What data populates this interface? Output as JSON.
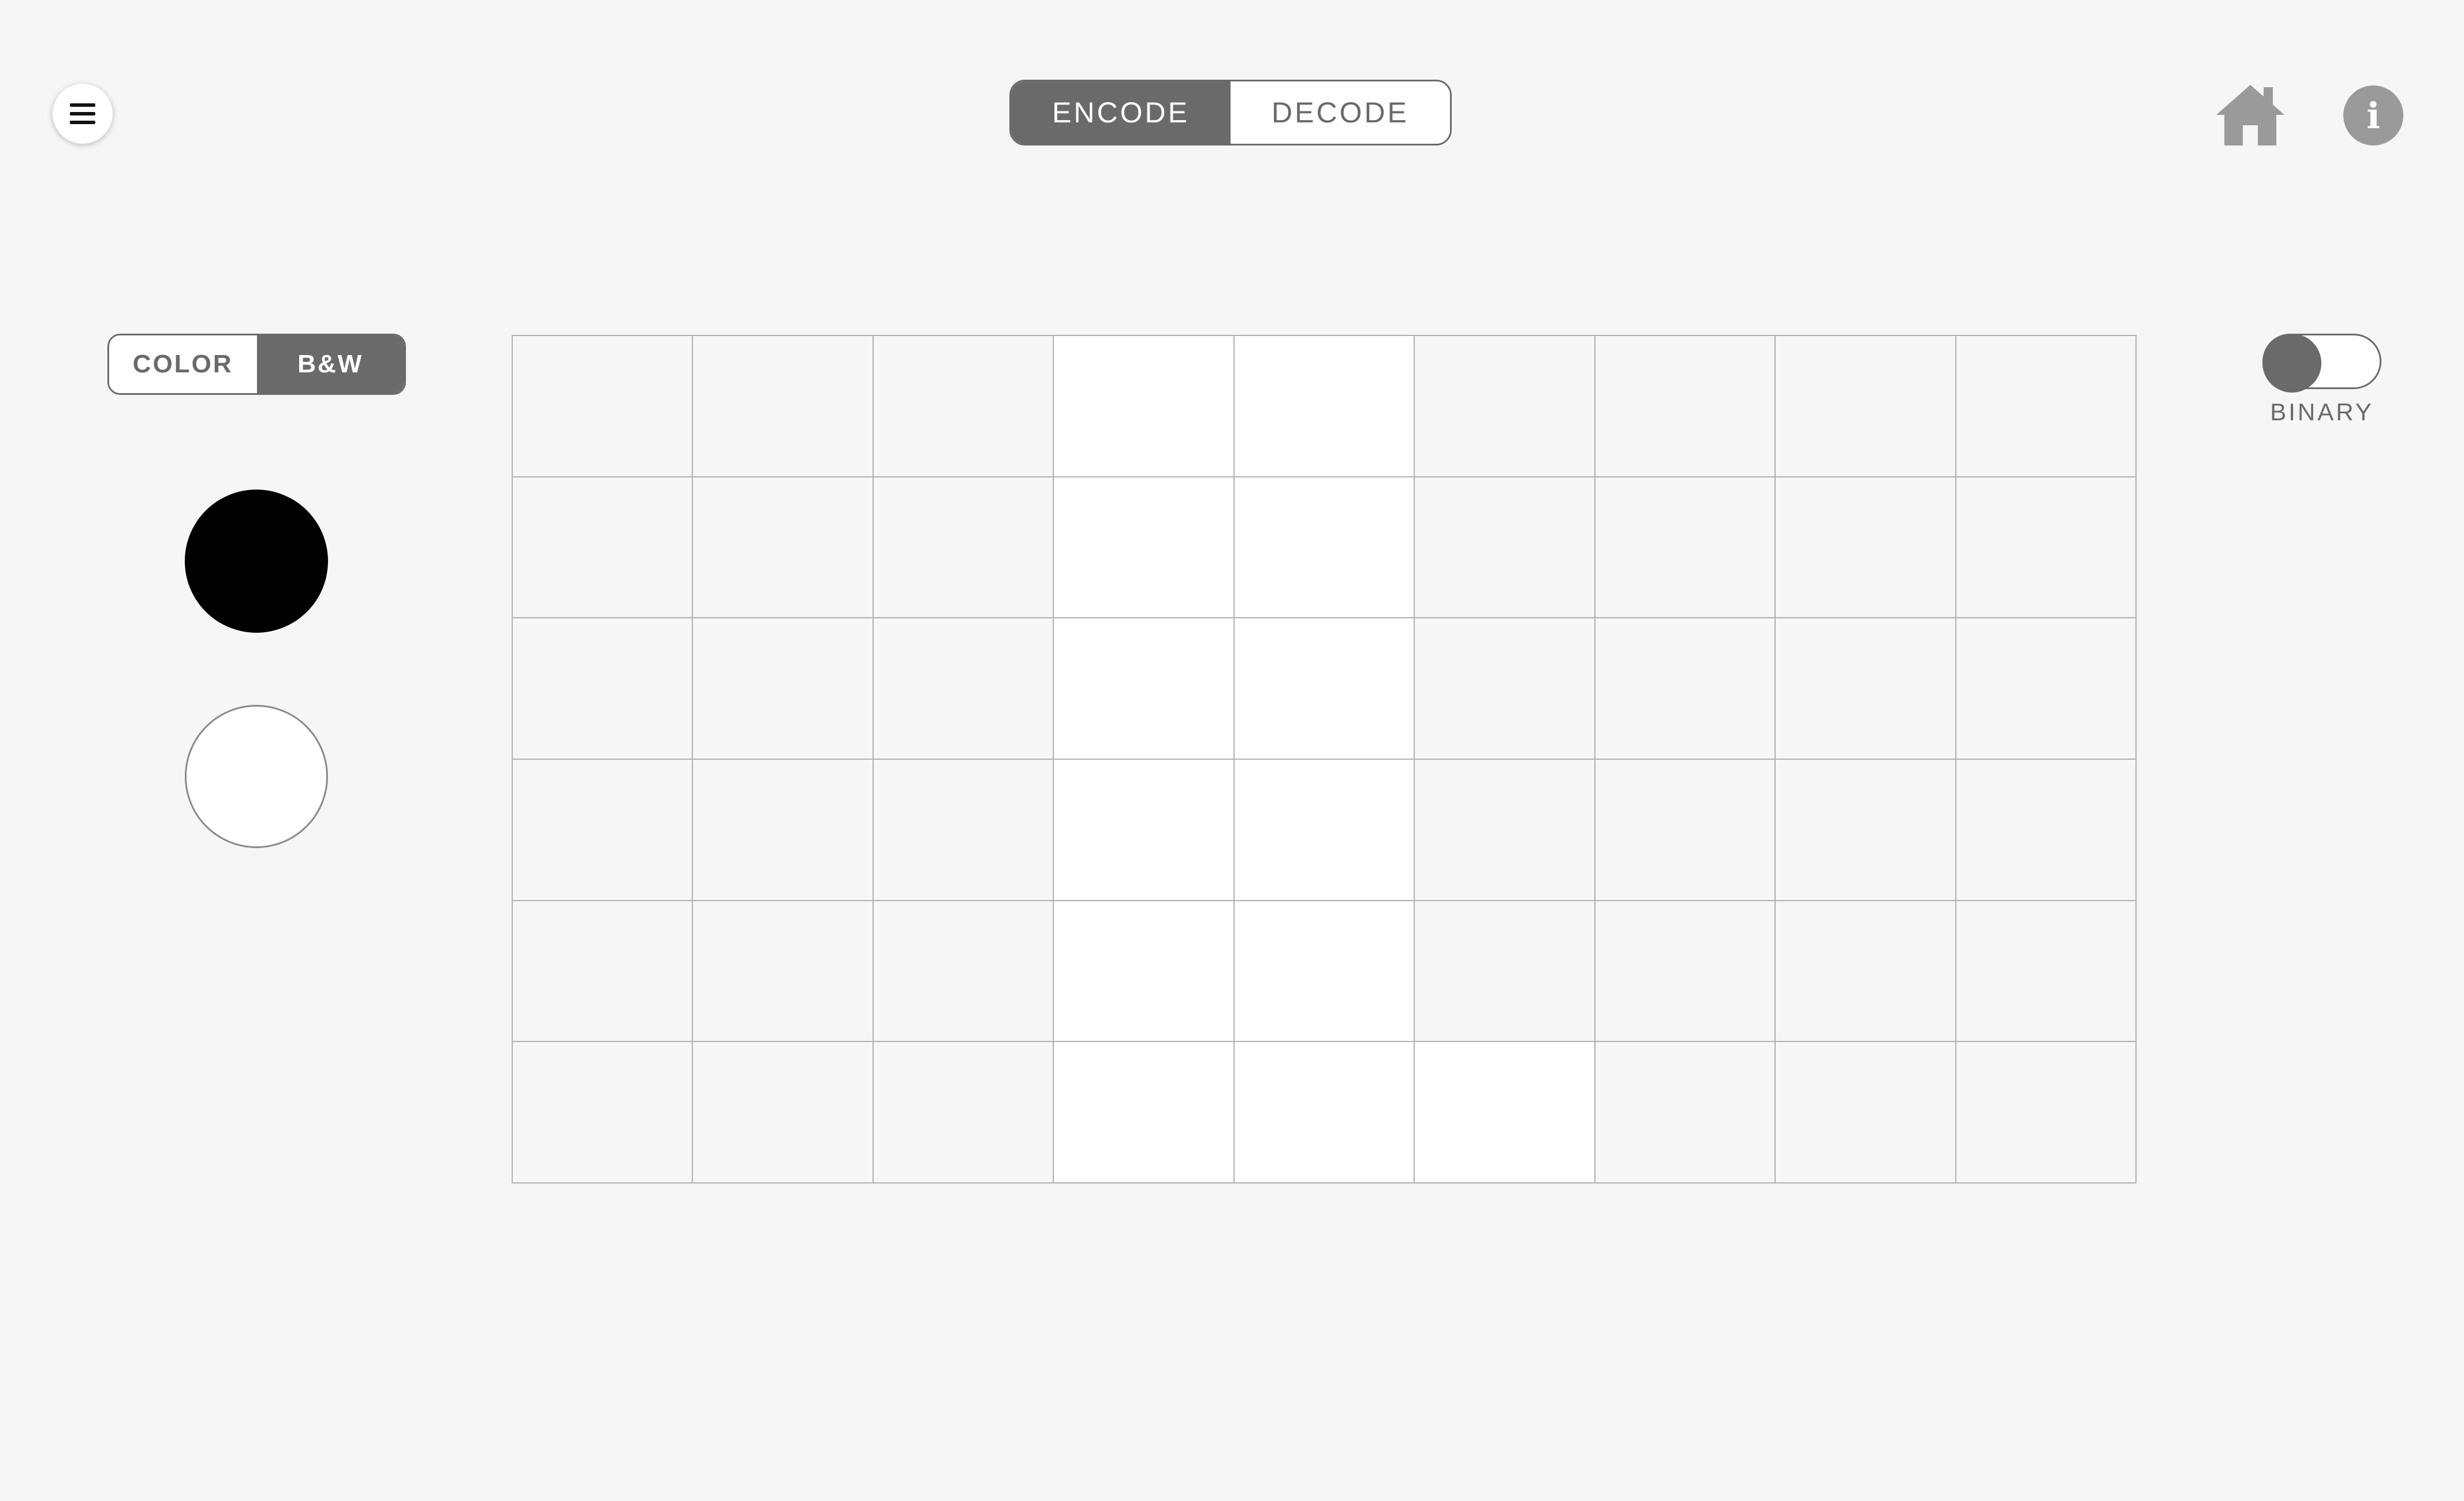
{
  "header": {
    "menu_icon": "hamburger-icon",
    "mode_tabs": [
      {
        "label": "ENCODE",
        "active": true
      },
      {
        "label": "DECODE",
        "active": false
      }
    ],
    "home_icon": "home-icon",
    "info_icon": "info-icon",
    "info_glyph": "i"
  },
  "palette": {
    "tabs": [
      {
        "label": "COLOR",
        "active": false
      },
      {
        "label": "B&W",
        "active": true
      }
    ],
    "swatches": [
      {
        "name": "black",
        "color": "#000000"
      },
      {
        "name": "white",
        "color": "#ffffff"
      }
    ]
  },
  "grid": {
    "columns": 9,
    "rows": 6,
    "empty_color": "#f6f6f6",
    "white_color": "#ffffff",
    "cells": [
      [
        0,
        0,
        0,
        1,
        1,
        0,
        0,
        0,
        0
      ],
      [
        0,
        0,
        0,
        1,
        1,
        0,
        0,
        0,
        0
      ],
      [
        0,
        0,
        0,
        1,
        1,
        0,
        0,
        0,
        0
      ],
      [
        0,
        0,
        0,
        1,
        1,
        0,
        0,
        0,
        0
      ],
      [
        0,
        0,
        0,
        1,
        1,
        0,
        0,
        0,
        0
      ],
      [
        0,
        0,
        0,
        1,
        1,
        1,
        0,
        0,
        0
      ]
    ]
  },
  "binary_toggle": {
    "label": "BINARY",
    "on": false
  },
  "colors": {
    "accent": "#6a6a6a",
    "background": "#f6f6f6",
    "icon_gray": "#9a9a9a"
  }
}
